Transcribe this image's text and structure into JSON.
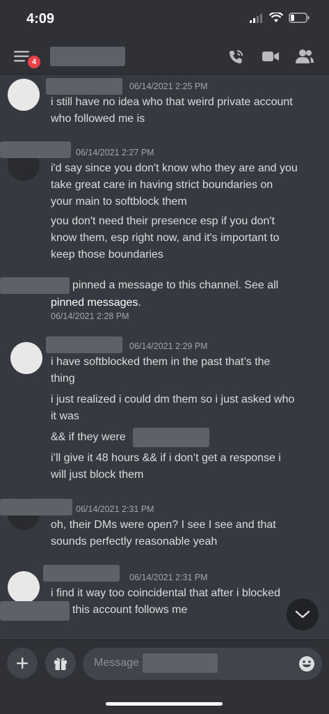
{
  "status_bar": {
    "time": "4:09"
  },
  "header": {
    "unread_badge": "4"
  },
  "messages": [
    {
      "timestamp": "06/14/2021 2:25 PM",
      "lines": [
        "i still have no idea who that weird private account",
        "who followed me is"
      ]
    },
    {
      "timestamp": "06/14/2021 2:27 PM",
      "lines": [
        "i'd say since you don't know who they are and you",
        "take great care in having strict boundaries on",
        "your main to softblock them"
      ],
      "lines2": [
        "you don't need their presence esp if you don't",
        "know them, esp right now, and it's important to",
        "keep those boundaries"
      ]
    },
    {
      "system_text": "pinned a message to this channel. See all",
      "link_text": "pinned messages",
      "link_suffix": ".",
      "timestamp": "06/14/2021 2:28 PM"
    },
    {
      "timestamp": "06/14/2021 2:29 PM",
      "lines": [
        "i have softblocked them in the past that’s the",
        "thing"
      ],
      "lines2": [
        "i just realized i could dm them so i just asked who",
        "it was"
      ],
      "line3": "&& if they were",
      "lines4": [
        "i’ll give it 48 hours && if i don’t get a response i",
        "will just block them"
      ]
    },
    {
      "timestamp": "06/14/2021 2:31 PM",
      "lines": [
        "oh, their DMs were open? I see I see and that",
        "sounds perfectly reasonable yeah"
      ]
    },
    {
      "timestamp": "06/14/2021 2:31 PM",
      "lines": [
        "i find it way too coincidental that after i blocked",
        "this account follows me"
      ]
    }
  ],
  "composer": {
    "placeholder": "Message"
  },
  "icons": [
    "menu-icon",
    "phone-call-icon",
    "video-icon",
    "members-icon",
    "plus-icon",
    "gift-icon",
    "emoji-icon",
    "chevron-down-icon",
    "signal-icon",
    "wifi-icon",
    "battery-icon"
  ],
  "colors": {
    "background": "#36393f",
    "header": "#2f3136",
    "badge": "#ed4245"
  }
}
